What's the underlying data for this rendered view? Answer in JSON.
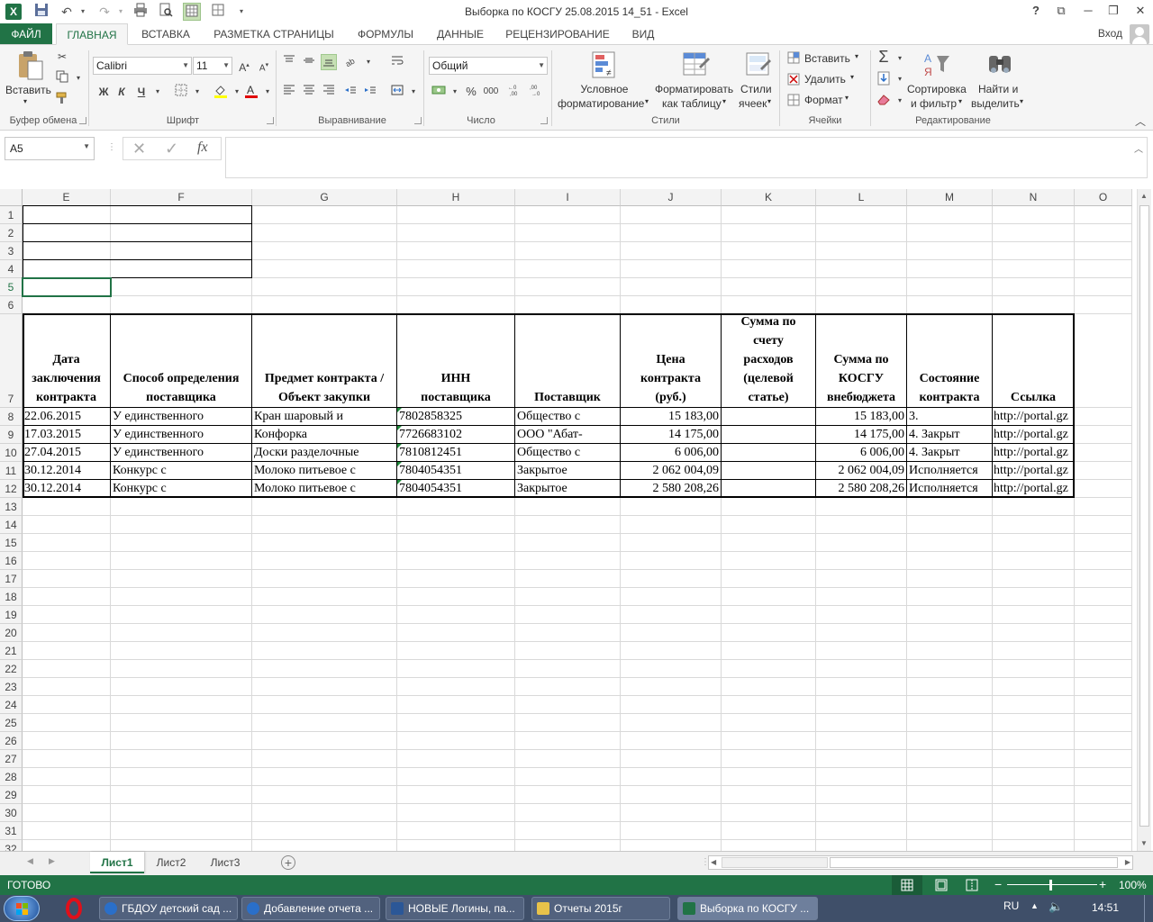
{
  "window": {
    "title": "Выборка по КОСГУ 25.08.2015 14_51 - Excel",
    "help": "?",
    "restore_ribbon": "⧉",
    "minimize": "─",
    "maximize": "❐",
    "close": "✕"
  },
  "quick_access": {
    "save_icon": "save-icon",
    "undo_icon": "undo-icon",
    "redo_icon": "redo-icon"
  },
  "tabs": [
    {
      "label": "ФАЙЛ"
    },
    {
      "label": "ГЛАВНАЯ"
    },
    {
      "label": "ВСТАВКА"
    },
    {
      "label": "РАЗМЕТКА СТРАНИЦЫ"
    },
    {
      "label": "ФОРМУЛЫ"
    },
    {
      "label": "ДАННЫЕ"
    },
    {
      "label": "РЕЦЕНЗИРОВАНИЕ"
    },
    {
      "label": "ВИД"
    }
  ],
  "login": "Вход",
  "ribbon": {
    "clipboard": {
      "paste": "Вставить",
      "group": "Буфер обмена"
    },
    "font": {
      "name": "Calibri",
      "size": "11",
      "bold": "Ж",
      "italic": "К",
      "underline": "Ч",
      "group": "Шрифт"
    },
    "alignment": {
      "group": "Выравнивание"
    },
    "number": {
      "format": "Общий",
      "percent": "%",
      "thousands": "000",
      "group": "Число"
    },
    "styles": {
      "conditional_1": "Условное",
      "conditional_2": "форматирование",
      "format_table_1": "Форматировать",
      "format_table_2": "как таблицу",
      "cell_styles_1": "Стили",
      "cell_styles_2": "ячеек",
      "group": "Стили"
    },
    "cells": {
      "insert": "Вставить",
      "delete": "Удалить",
      "format": "Формат",
      "group": "Ячейки"
    },
    "editing": {
      "sort_1": "Сортировка",
      "sort_2": "и фильтр",
      "find_1": "Найти и",
      "find_2": "выделить",
      "group": "Редактирование"
    }
  },
  "formula_bar": {
    "name_box": "A5",
    "fx": "fx",
    "value": ""
  },
  "columns": [
    "E",
    "F",
    "G",
    "H",
    "I",
    "J",
    "K",
    "L",
    "M",
    "N",
    "O"
  ],
  "rows": [
    "1",
    "2",
    "3",
    "4",
    "5",
    "6",
    "7",
    "8",
    "9",
    "10",
    "11",
    "12",
    "13",
    "14",
    "15",
    "16",
    "17",
    "18",
    "19",
    "20",
    "21",
    "22",
    "23",
    "24",
    "25",
    "26",
    "27",
    "28",
    "29",
    "30",
    "31",
    "32"
  ],
  "table": {
    "headers": {
      "date": [
        "Дата",
        "заключения",
        "контракта"
      ],
      "method": [
        "Способ определения",
        "поставщика"
      ],
      "subject": [
        "Предмет контракта /",
        "Объект закупки"
      ],
      "inn": [
        "ИНН",
        "поставщика"
      ],
      "supplier": [
        "Поставщик"
      ],
      "price": [
        "Цена",
        "контракта",
        "(руб.)"
      ],
      "sum_expense": [
        "Сумма по",
        "счету",
        "расходов",
        "(целевой",
        "статье)"
      ],
      "sum_kosgu": [
        "Сумма по",
        "КОСГУ",
        "внебюджета"
      ],
      "status": [
        "Состояние",
        "контракта"
      ],
      "link": [
        "Ссылка"
      ]
    },
    "rows": [
      {
        "date": "22.06.2015",
        "method": "У единственного",
        "subject": "Кран шаровый и",
        "inn": "7802858325",
        "supplier": "Общество с",
        "price": "15 183,00",
        "sum_expense": "",
        "sum_kosgu": "15 183,00",
        "status": "3.",
        "link": "http://portal.gz"
      },
      {
        "date": "17.03.2015",
        "method": "У единственного",
        "subject": "Конфорка",
        "inn": "7726683102",
        "supplier": "ООО \"Абат-",
        "price": "14 175,00",
        "sum_expense": "",
        "sum_kosgu": "14 175,00",
        "status": "4. Закрыт",
        "link": "http://portal.gz"
      },
      {
        "date": "27.04.2015",
        "method": "У единственного",
        "subject": "Доски разделочные",
        "inn": "7810812451",
        "supplier": "Общество с",
        "price": "6 006,00",
        "sum_expense": "",
        "sum_kosgu": "6 006,00",
        "status": "4. Закрыт",
        "link": "http://portal.gz"
      },
      {
        "date": "30.12.2014",
        "method": "Конкурс с",
        "subject": "Молоко питьевое с",
        "inn": "7804054351",
        "supplier": "Закрытое",
        "price": "2 062 004,09",
        "sum_expense": "",
        "sum_kosgu": "2 062 004,09",
        "status": "Исполняется",
        "link": "http://portal.gz"
      },
      {
        "date": "30.12.2014",
        "method": "Конкурс с",
        "subject": "Молоко питьевое с",
        "inn": "7804054351",
        "supplier": "Закрытое",
        "price": "2 580 208,26",
        "sum_expense": "",
        "sum_kosgu": "2 580 208,26",
        "status": "Исполняется",
        "link": "http://portal.gz"
      }
    ]
  },
  "sheets": [
    {
      "label": "Лист1"
    },
    {
      "label": "Лист2"
    },
    {
      "label": "Лист3"
    }
  ],
  "status": {
    "ready": "ГОТОВО",
    "zoom": "100%"
  },
  "taskbar": {
    "items": [
      {
        "label": "ГБДОУ детский сад ...",
        "color": "#2a6fc9"
      },
      {
        "label": "Добавление отчета ...",
        "color": "#2a6fc9"
      },
      {
        "label": "НОВЫЕ Логины, па...",
        "color": "#2b5797"
      },
      {
        "label": "Отчеты 2015г",
        "color": "#e8c24a"
      },
      {
        "label": "Выборка по КОСГУ ...",
        "color": "#217346"
      }
    ],
    "lang": "RU",
    "time": "14:51"
  },
  "colors": {
    "accent": "#217346",
    "taskbar": "#3f4f69"
  }
}
